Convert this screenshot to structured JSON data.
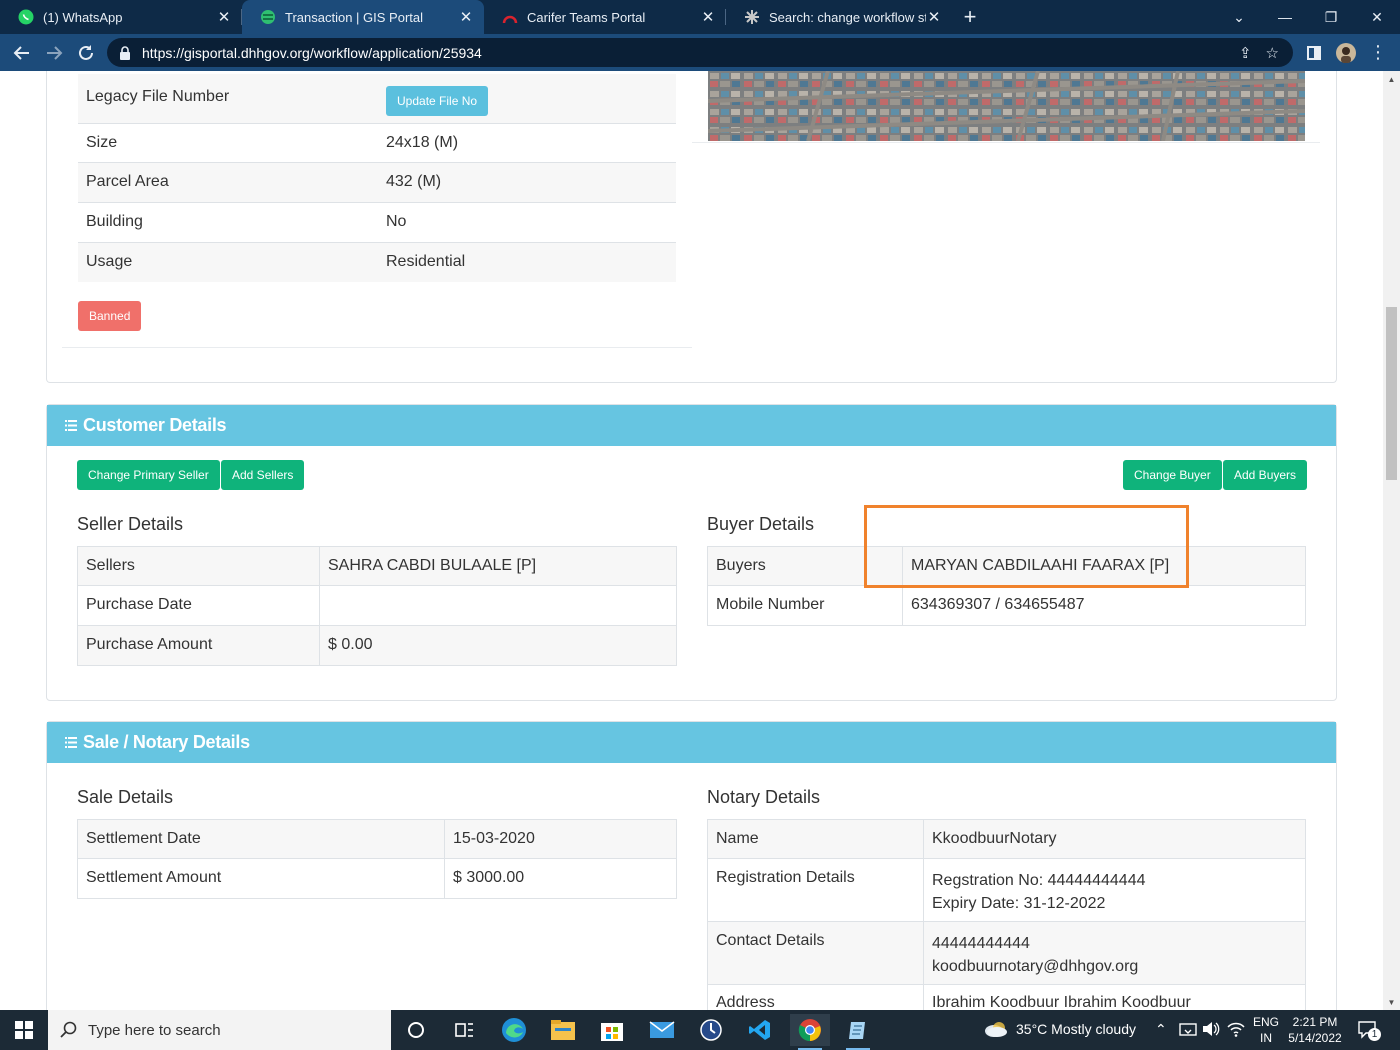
{
  "browser": {
    "tabs": [
      {
        "label": "(1) WhatsApp",
        "icon": "whatsapp-icon",
        "active": false
      },
      {
        "label": "Transaction | GIS Portal",
        "icon": "gis-portal-icon",
        "active": true
      },
      {
        "label": "Carifer Teams Portal",
        "icon": "teams-portal-icon",
        "active": false
      },
      {
        "label": "Search: change workflow status -",
        "icon": "search-tab-icon",
        "active": false
      }
    ],
    "url": "https://gisportal.dhhgov.org/workflow/application/25934"
  },
  "property": {
    "rows": [
      {
        "label": "Legacy File Number",
        "value": ""
      },
      {
        "label": "Size",
        "value": "24x18 (M)"
      },
      {
        "label": "Parcel Area",
        "value": "432 (M)"
      },
      {
        "label": "Building",
        "value": "No"
      },
      {
        "label": "Usage",
        "value": "Residential"
      }
    ],
    "update_file_label": "Update File No",
    "banned_label": "Banned"
  },
  "customer": {
    "header": "Customer Details",
    "change_primary_seller": "Change Primary Seller",
    "add_sellers": "Add Sellers",
    "change_buyer": "Change Buyer",
    "add_buyers": "Add Buyers",
    "seller_title": "Seller Details",
    "seller_rows": [
      {
        "label": "Sellers",
        "value": "SAHRA CABDI BULAALE [P]"
      },
      {
        "label": "Purchase Date",
        "value": ""
      },
      {
        "label": "Purchase Amount",
        "value": "$ 0.00"
      }
    ],
    "buyer_title": "Buyer Details",
    "buyer_rows": [
      {
        "label": "Buyers",
        "value": "MARYAN CABDILAAHI FAARAX [P]"
      },
      {
        "label": "Mobile Number",
        "value": "634369307 / 634655487"
      }
    ]
  },
  "sale": {
    "header": "Sale / Notary Details",
    "sale_title": "Sale Details",
    "sale_rows": [
      {
        "label": "Settlement Date",
        "value": "15-03-2020"
      },
      {
        "label": "Settlement Amount",
        "value": "$ 3000.00"
      }
    ],
    "notary_title": "Notary Details",
    "notary_rows": [
      {
        "label": "Name",
        "line1": "KkoodbuurNotary",
        "line2": ""
      },
      {
        "label": "Registration Details",
        "line1": "Regstration No: 44444444444",
        "line2": "Expiry Date: 31-12-2022"
      },
      {
        "label": "Contact Details",
        "line1": "44444444444",
        "line2": "koodbuurnotary@dhhgov.org"
      },
      {
        "label": "Address",
        "line1": "Ibrahim Koodbuur Ibrahim Koodbuur",
        "line2": ""
      }
    ]
  },
  "taskbar": {
    "search_placeholder": "Type here to search",
    "weather": "35°C  Mostly cloudy",
    "lang1": "ENG",
    "lang2": "IN",
    "time": "2:21 PM",
    "date": "5/14/2022",
    "notifications": "1"
  },
  "colors": {
    "header_bg": "#66c5e1",
    "btn_green": "#0fb37b",
    "btn_cyan": "#5bc0de",
    "btn_red": "#f0706a",
    "highlight": "#f0822c"
  }
}
